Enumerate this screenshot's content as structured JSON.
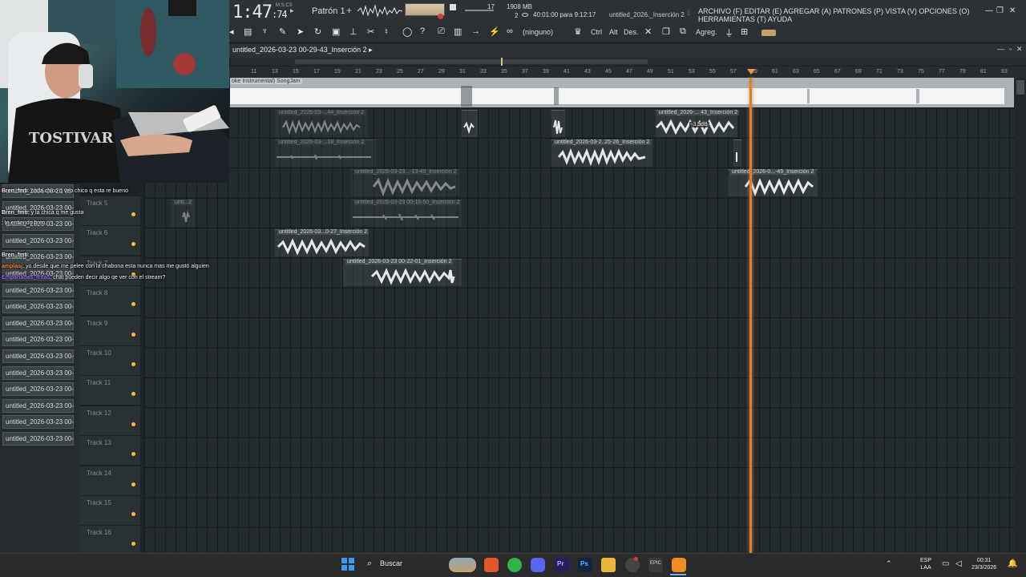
{
  "titlebar": {
    "time_main": "1:47",
    "time_sub": ":74",
    "time_unit": "M:S:CS",
    "pattern": "Patrón 1",
    "cpu": "17",
    "ram": "1908 MB",
    "ram_count": "2",
    "timer": "40:01:00 para 9:12:17",
    "project": "untitled_2026._Inserción 2",
    "menu": "ARCHIVO (F) EDITAR (E) AGREGAR (A) PATRONES (P) VISTA (V) OPCIONES (O) HERRAMIENTAS (T) AYUDA"
  },
  "toolbar": {
    "snap": "(ninguno)",
    "ctrl": "Ctrl",
    "alt": "Alt",
    "des": "Des.",
    "agreg": "Agreg."
  },
  "playlist": {
    "title": "untitled_2026-03-23 00-29-43_Inserción 2",
    "song_clip": "oke Instrumental)  SongJam",
    "ruler": [
      "11",
      "13",
      "15",
      "17",
      "19",
      "21",
      "23",
      "25",
      "27",
      "29",
      "31",
      "33",
      "35",
      "37",
      "39",
      "41",
      "43",
      "45",
      "47",
      "49",
      "51",
      "53",
      "55",
      "57",
      "59",
      "61",
      "63",
      "65",
      "67",
      "69",
      "71",
      "73",
      "75",
      "77",
      "79",
      "81",
      "83"
    ],
    "tracks": [
      "Track 5",
      "Track 6",
      "Track 7",
      "Track 8",
      "Track 9",
      "Track 10",
      "Track 11",
      "Track 12",
      "Track 13",
      "Track 14",
      "Track 15",
      "Track 16"
    ],
    "clips": [
      {
        "name": "untitled_2026-03-...44_Inserción 2"
      },
      {
        "name": "untitled_2026-... 43_Inserción 2",
        "db": "-3.5dB"
      },
      {
        "name": "untitled_2026-03-...18_Inserción 2"
      },
      {
        "name": "untitled_2026-03-2..25-26_Inserción 2"
      },
      {
        "name": "untitled_2026-03-23...-13-49_Inserción 2"
      },
      {
        "name": "untitled_2026-0...-49_Inserción 2"
      },
      {
        "name": "untitled_2026-03-23 00-16-50_Inserción 2"
      },
      {
        "name": "untitled_2026-03...0-27_Inserción 2"
      },
      {
        "name": "untitled_2026-03-23 00-22-01_Inserción 2"
      },
      {
        "name": "unti...2"
      }
    ]
  },
  "clip_list": [
    "untitled_2026-03-23 00-",
    "untitled_2026-03-23 00-",
    "untitled_2026-03-23 00-",
    "untitled_2026-03-23 00-",
    "untitled_2026-03-23 00-",
    "untitled_2026-03-23 00-",
    "untitled_2026-03-23 00-",
    "untitled_2026-03-23 00-",
    "untitled_2026-03-23 00-",
    "untitled_2026-03-23 00-",
    "untitled_2026-03-23 00-",
    "untitled_2026-03-23 00-",
    "untitled_2026-03-23 00-",
    "untitled_2026-03-23 00-",
    "untitled_2026-03-23 00-",
    "untitled_2026-03-23 00-"
  ],
  "chat": [
    {
      "user": "Bren_fmti",
      "msg": ": cada chico q veo chico q esta re bueno",
      "color": "#f0f0f0"
    },
    {
      "user": "Bren_fmti",
      "msg": ": y la chica q me gusta",
      "color": "#f0f0f0"
    },
    {
      "user": "",
      "msg": ": te entiendo bren",
      "color": "#b06be0"
    },
    {
      "user": "Bren_fmti",
      "msg": ":",
      "color": "#f0f0f0"
    },
    {
      "user": "amplasj",
      "msg": ": yo desde que me pelee con la chabona esta nunca mas me gustó alguien",
      "color": "#ff8c3a"
    },
    {
      "user": "Empanadas_fritas",
      "msg": ": chat pueden decir algo qe ver con el stream?",
      "color": "#9b6ef2"
    }
  ],
  "taskbar": {
    "search": "Buscar",
    "lang1": "ESP",
    "lang2": "LAA",
    "clock": "00:31",
    "date": "23/3/2026"
  }
}
